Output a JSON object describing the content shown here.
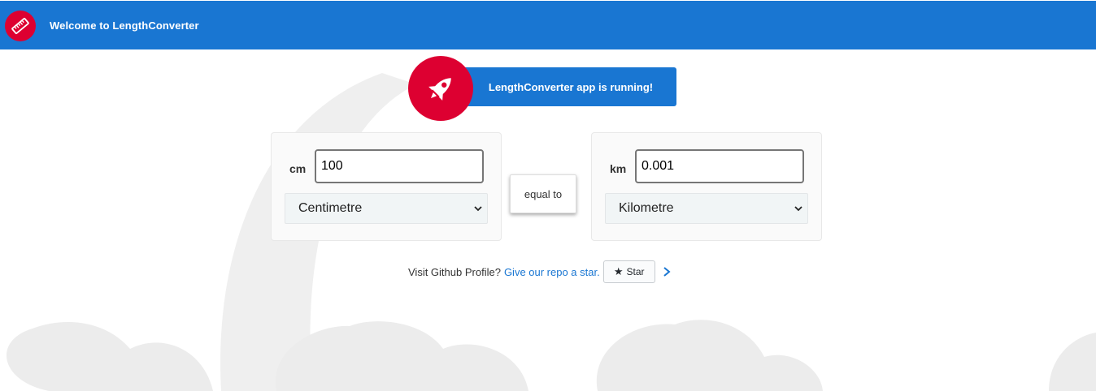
{
  "toolbar": {
    "title": "Welcome to LengthConverter",
    "logo_icon": "ruler-icon",
    "background_color": "#1976d2"
  },
  "banner": {
    "text": "LengthConverter app is running!",
    "icon": "rocket-icon",
    "accent_color": "#dd0031"
  },
  "converter": {
    "from": {
      "unit_abbr": "cm",
      "value": "100",
      "selected_unit": "Centimetre"
    },
    "equal_label": "equal to",
    "to": {
      "unit_abbr": "km",
      "value": "0.001",
      "selected_unit": "Kilometre"
    }
  },
  "github": {
    "question": "Visit Github Profile?",
    "link_text": "Give our repo a star.",
    "star_label": "Star",
    "star_icon": "star-icon",
    "chevron_icon": "chevron-right-icon"
  }
}
